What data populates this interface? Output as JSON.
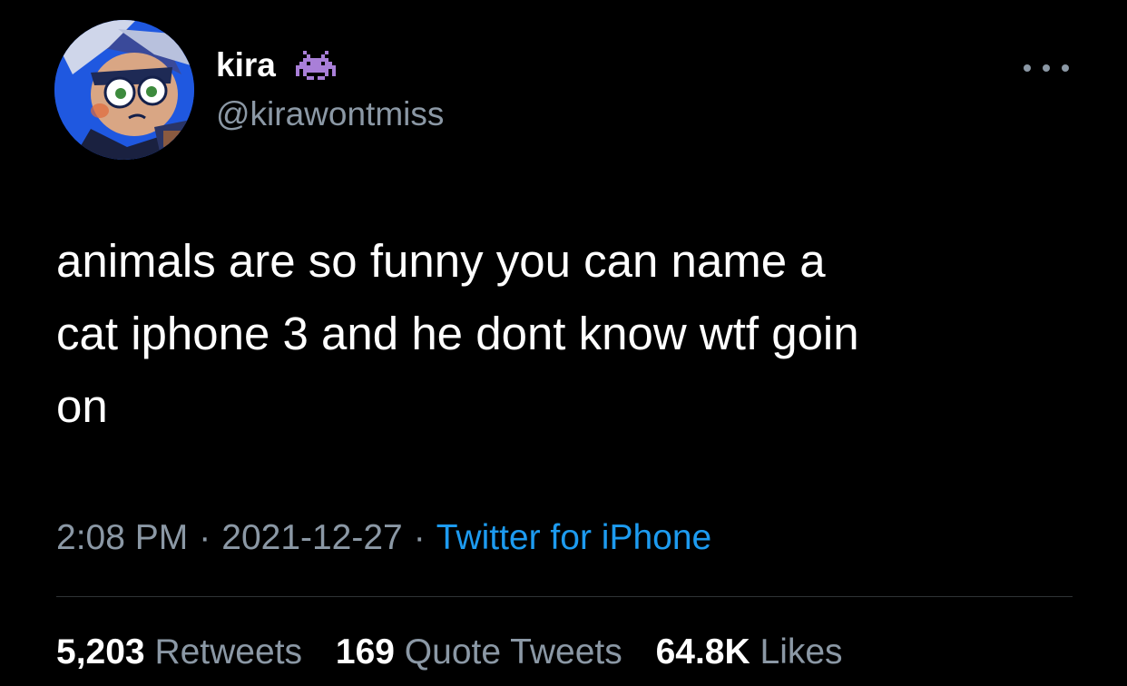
{
  "author": {
    "display_name": "kira",
    "handle": "@kirawontmiss",
    "badge_icon": "alien-monster-icon",
    "avatar_icon": "cartoon-avatar-icon"
  },
  "more_icon": "more-options-icon",
  "tweet": {
    "text": "animals are so funny you can name a\ncat iphone 3 and he dont know wtf goin\non"
  },
  "meta": {
    "time": "2:08 PM",
    "separator": "·",
    "date": "2021-12-27",
    "source": "Twitter for iPhone"
  },
  "stats": {
    "retweets_count": "5,203",
    "retweets_label": "Retweets",
    "quotes_count": "169",
    "quotes_label": "Quote Tweets",
    "likes_count": "64.8K",
    "likes_label": "Likes"
  },
  "colors": {
    "background": "#000000",
    "text_primary": "#ffffff",
    "text_secondary": "#8b98a5",
    "link": "#1d9bf0",
    "divider": "#2f3336",
    "badge": "#a97fd8"
  }
}
